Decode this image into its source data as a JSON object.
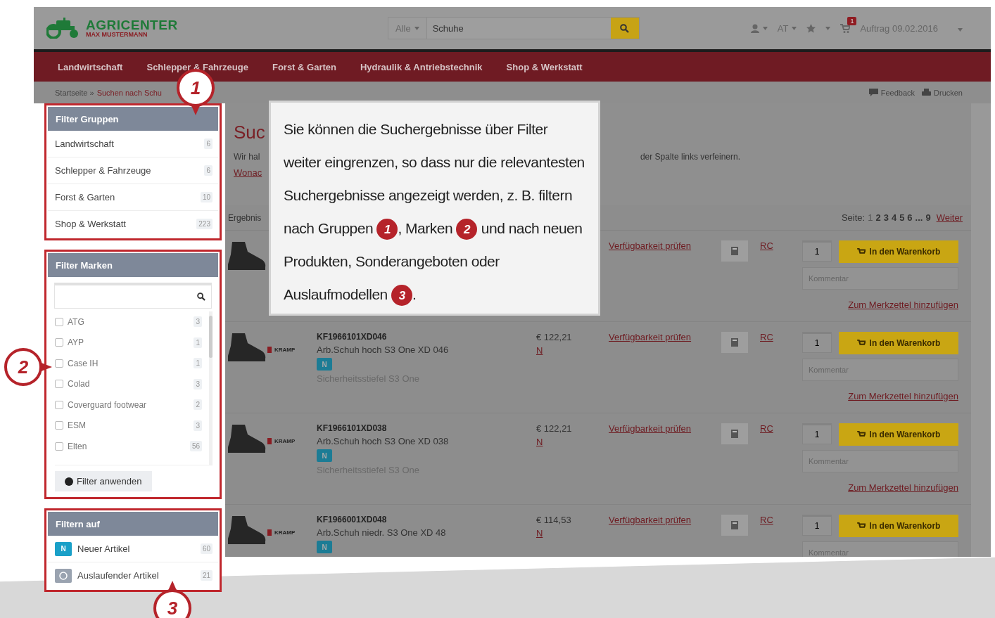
{
  "header": {
    "logo_title": "AGRICENTER",
    "logo_subtitle": "MAX MUSTERMANN",
    "search": {
      "category": "Alle",
      "value": "Schuhe"
    },
    "language": "AT",
    "cart_count": "1",
    "order": "Auftrag 09.02.2016"
  },
  "nav": [
    "Landwirtschaft",
    "Schlepper & Fahrzeuge",
    "Forst & Garten",
    "Hydraulik & Antriebstechnik",
    "Shop & Werkstatt"
  ],
  "breadcrumb": {
    "home": "Startseite »",
    "current": "Suchen nach Schu"
  },
  "page_actions": [
    {
      "kind": "feedback",
      "label": "Feedback"
    },
    {
      "kind": "print",
      "label": "Drucken"
    }
  ],
  "sidebar": {
    "groups": {
      "title": "Filter Gruppen",
      "items": [
        {
          "label": "Landwirtschaft",
          "count": "6"
        },
        {
          "label": "Schlepper & Fahrzeuge",
          "count": "6"
        },
        {
          "label": "Forst & Garten",
          "count": "10"
        },
        {
          "label": "Shop & Werkstatt",
          "count": "223"
        }
      ]
    },
    "brands": {
      "title": "Filter Marken",
      "items": [
        {
          "label": "ATG",
          "count": "3",
          "checked": false
        },
        {
          "label": "AYP",
          "count": "1",
          "checked": false
        },
        {
          "label": "Case IH",
          "count": "1",
          "checked": false
        },
        {
          "label": "Colad",
          "count": "3",
          "checked": false
        },
        {
          "label": "Coverguard footwear",
          "count": "2",
          "checked": false
        },
        {
          "label": "ESM",
          "count": "3",
          "checked": false
        },
        {
          "label": "Elten",
          "count": "56",
          "checked": false
        }
      ],
      "button": "Filter anwenden"
    },
    "filter_on": {
      "title": "Filtern auf",
      "items": [
        {
          "kind": "new",
          "badge": "N",
          "label": "Neuer Artikel",
          "count": "60"
        },
        {
          "kind": "discontinued",
          "label": "Auslaufender Artikel",
          "count": "21"
        }
      ]
    }
  },
  "results": {
    "title": "Suc",
    "intro_start": "Wir hal",
    "intro_end": "der Spalte links verfeinern.",
    "link": "Wonac",
    "per_page_label": "Ergebnis",
    "pagination": {
      "label": "Seite:",
      "pages": [
        {
          "kind": "page",
          "label": "1",
          "selected": true
        },
        {
          "kind": "page",
          "label": "2",
          "selected": false
        },
        {
          "kind": "page",
          "label": "3",
          "selected": false
        },
        {
          "kind": "page",
          "label": "4",
          "selected": false
        },
        {
          "kind": "page",
          "label": "5",
          "selected": false
        },
        {
          "kind": "page",
          "label": "6",
          "selected": false
        },
        {
          "kind": "gap",
          "label": "..."
        },
        {
          "kind": "page",
          "label": "9",
          "selected": false
        }
      ],
      "next": "Weiter"
    }
  },
  "products": [
    {
      "availability": "Verfügbarkeit prüfen",
      "rc": "RC",
      "qty": "1",
      "cart": "In den Warenkorb",
      "comment_placeholder": "Kommentar",
      "wishlist": "Zum Merkzettel hinzufügen"
    },
    {
      "brand": "KRAMP",
      "code": "KF1966101XD046",
      "name": "Arb.Schuh hoch S3 One XD 046",
      "badge": "N",
      "description": "Sicherheitsstiefel S3 One",
      "price": "€ 122,21",
      "stock": "N",
      "availability": "Verfügbarkeit prüfen",
      "rc": "RC",
      "qty": "1",
      "cart": "In den Warenkorb",
      "comment_placeholder": "Kommentar",
      "wishlist": "Zum Merkzettel hinzufügen"
    },
    {
      "brand": "KRAMP",
      "code": "KF1966101XD038",
      "name": "Arb.Schuh hoch S3 One XD 038",
      "badge": "N",
      "description": "Sicherheitsstiefel S3 One",
      "price": "€ 122,21",
      "stock": "N",
      "availability": "Verfügbarkeit prüfen",
      "rc": "RC",
      "qty": "1",
      "cart": "In den Warenkorb",
      "comment_placeholder": "Kommentar",
      "wishlist": "Zum Merkzettel hinzufügen"
    },
    {
      "brand": "KRAMP",
      "code": "KF1966001XD048",
      "name": "Arb.Schuh niedr. S3 One XD 48",
      "badge": "N",
      "price": "€ 114,53",
      "stock": "N",
      "availability": "Verfügbarkeit prüfen",
      "rc": "RC",
      "qty": "1",
      "cart": "In den Warenkorb",
      "comment_placeholder": "Kommentar"
    }
  ],
  "callout": {
    "parts": [
      {
        "kind": "text",
        "text": "Sie können die Suchergebnisse über Filter weiter eingrenzen, so dass nur die relevantesten Suchergebnisse angezeigt werden, z. B. filtern nach Gruppen "
      },
      {
        "kind": "marker",
        "text": "1"
      },
      {
        "kind": "text",
        "text": ", Marken "
      },
      {
        "kind": "marker",
        "text": "2"
      },
      {
        "kind": "text",
        "text": " und nach neuen Produkten, Sonderangeboten oder Auslaufmodellen "
      },
      {
        "kind": "marker",
        "text": "3"
      },
      {
        "kind": "text",
        "text": "."
      }
    ]
  },
  "markers": [
    {
      "number": "1"
    },
    {
      "number": "2"
    },
    {
      "number": "3"
    }
  ]
}
